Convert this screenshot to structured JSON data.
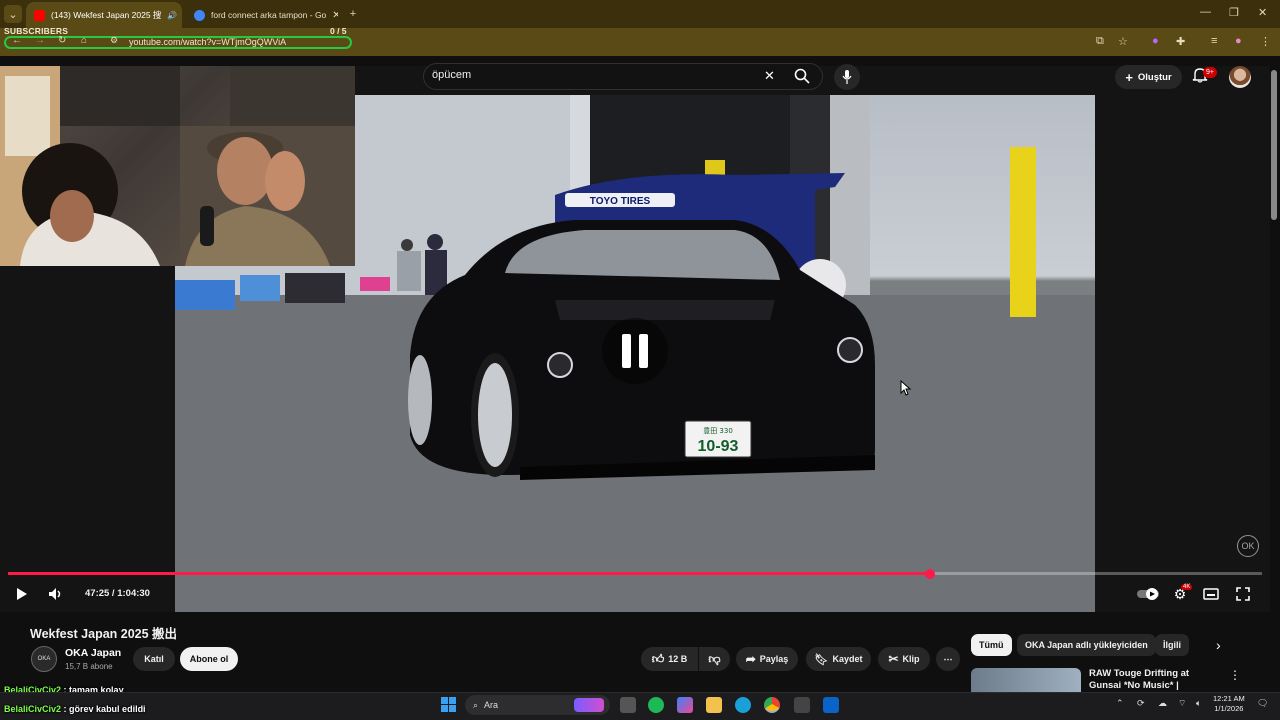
{
  "browser": {
    "tabs": [
      {
        "label": "(143) Wekfest Japan 2025 搜",
        "active": true,
        "favicon_color": "#ff0000"
      },
      {
        "label": "ford connect arka tampon - Go",
        "active": false,
        "favicon_color": "#4285f4"
      }
    ],
    "url": "youtube.com/watch?v=WTjmOgQWViA",
    "overlay_label": "SUBSCRIBERS",
    "overlay_count": "0 / 5",
    "accent": "#5a4a15"
  },
  "youtube": {
    "search_value": "öpücem",
    "create_label": "Oluştur",
    "notif_badge": "9+"
  },
  "player": {
    "time_display": "47:25 / 1:04:30",
    "progress_fraction": 0.735,
    "progress_color": "#ff1a48",
    "plate_top": "豊田 330",
    "plate_num": "10-93",
    "brand_sticker": "TOYO TIRES",
    "watermark": "OK"
  },
  "video": {
    "title": "Wekfest Japan 2025 搬出",
    "channel_name": "OKA Japan",
    "channel_subs": "15,7 B abone",
    "join_label": "Katıl",
    "subscribe_label": "Abone ol",
    "like_count": "12 B",
    "share_label": "Paylaş",
    "save_label": "Kaydet",
    "clip_label": "Klip"
  },
  "related": {
    "chips": [
      "Tümü",
      "OKA Japan adlı yükleyiciden",
      "İlgili"
    ],
    "first_title": "RAW Touge Drifting at Gunsai *No Music* | HARDCORE Toky"
  },
  "chat": [
    {
      "user": "BelaliCivCiv2",
      "message": ": tamam kolay"
    },
    {
      "user": "BelaliCivCiv2",
      "message": ": görev kabul edildi"
    }
  ],
  "taskbar": {
    "search_placeholder": "Ara",
    "time": "12:21 AM",
    "date": "1/1/2026"
  }
}
